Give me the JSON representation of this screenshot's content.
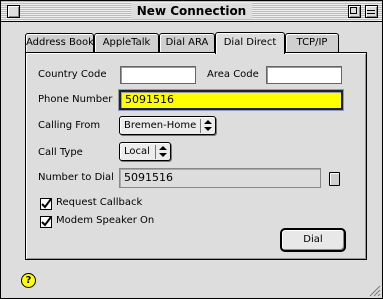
{
  "window": {
    "title": "New Connection"
  },
  "tabs": [
    {
      "label": "Address Books",
      "active": false
    },
    {
      "label": "AppleTalk",
      "active": false
    },
    {
      "label": "Dial ARA",
      "active": false
    },
    {
      "label": "Dial Direct",
      "active": true
    },
    {
      "label": "TCP/IP",
      "active": false
    }
  ],
  "form": {
    "country_code": {
      "label": "Country Code",
      "value": ""
    },
    "area_code": {
      "label": "Area Code",
      "value": ""
    },
    "phone_number": {
      "label": "Phone Number",
      "value": "5091516"
    },
    "calling_from": {
      "label": "Calling From",
      "value": "Bremen-Home"
    },
    "call_type": {
      "label": "Call Type",
      "value": "Local"
    },
    "number_to_dial": {
      "label": "Number to Dial",
      "value": "5091516"
    },
    "request_callback": {
      "label": "Request Callback",
      "checked": true
    },
    "modem_speaker": {
      "label": "Modem Speaker On",
      "checked": true
    },
    "dial_button": "Dial"
  },
  "help": {
    "glyph": "?"
  },
  "colors": {
    "focused_field": "#ffff00",
    "window_bg": "#dddddd"
  }
}
